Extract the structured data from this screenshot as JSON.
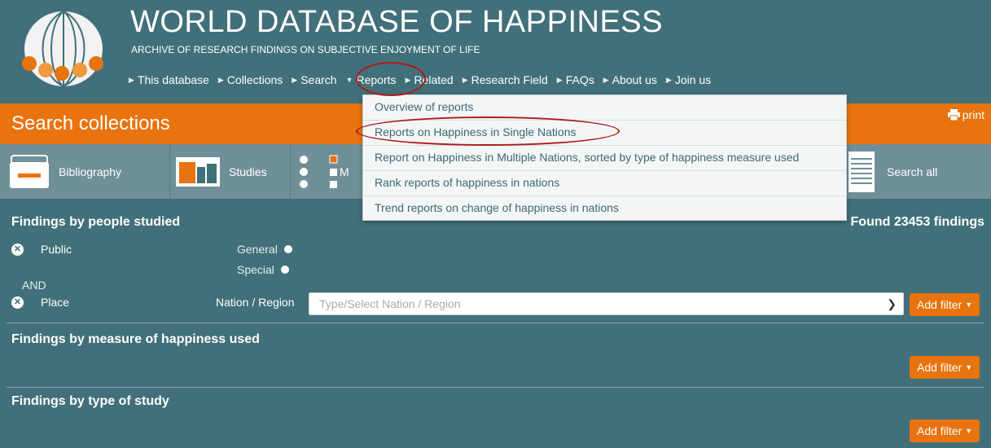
{
  "header": {
    "title": "WORLD DATABASE OF HAPPINESS",
    "subtitle": "ARCHIVE OF RESEARCH FINDINGS ON SUBJECTIVE ENJOYMENT OF LIFE",
    "nav": [
      {
        "label": "This database"
      },
      {
        "label": "Collections"
      },
      {
        "label": "Search"
      },
      {
        "label": "Reports"
      },
      {
        "label": "Related"
      },
      {
        "label": "Research Field"
      },
      {
        "label": "FAQs"
      },
      {
        "label": "About us"
      },
      {
        "label": "Join us"
      }
    ]
  },
  "title_bar": {
    "page_title": "Search collections",
    "print_label": "print"
  },
  "tabs": {
    "bibliography": "Bibliography",
    "studies": "Studies",
    "measures_partial": "M",
    "search_all": "Search all"
  },
  "reports_menu": {
    "items": [
      "Overview of reports",
      "Reports on Happiness in Single Nations",
      "Report on Happiness in Multiple Nations, sorted by type of happiness measure used",
      "Rank reports of happiness in nations",
      "Trend reports on change of happiness in nations"
    ]
  },
  "findings": {
    "people_title": "Findings by people studied",
    "found_count": "Found 23453 findings",
    "public_label": "Public",
    "general_label": "General",
    "special_label": "Special",
    "and_label": "AND",
    "place_label": "Place",
    "region_label": "Nation / Region",
    "region_placeholder": "Type/Select Nation / Region",
    "measure_title": "Findings by measure of happiness used",
    "study_title": "Findings by type of study",
    "add_filter_label": "Add filter"
  },
  "colors": {
    "background": "#41707a",
    "accent": "#e8730f",
    "tab_bar": "#6f9098",
    "highlight": "#b01a1a"
  }
}
